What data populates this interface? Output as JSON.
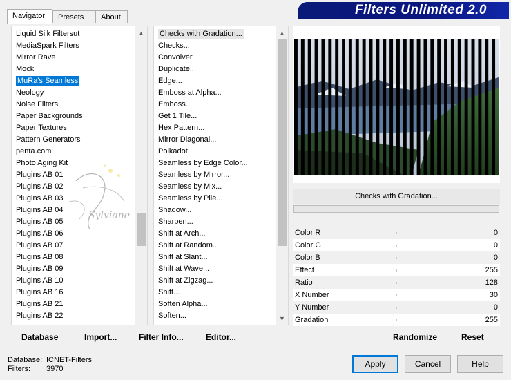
{
  "banner": {
    "title": "Filters Unlimited 2.0"
  },
  "tabs": [
    {
      "label": "Navigator",
      "active": true
    },
    {
      "label": "Presets",
      "active": false
    },
    {
      "label": "About",
      "active": false
    }
  ],
  "categories": {
    "selected_index": 4,
    "items": [
      "Liquid Silk Filtersut",
      "MediaSpark Filters",
      "Mirror Rave",
      "Mock",
      "MuRa's Seamless",
      "Neology",
      "Noise Filters",
      "Paper Backgrounds",
      "Paper Textures",
      "Pattern Generators",
      "penta.com",
      "Photo Aging Kit",
      "Plugins AB 01",
      "Plugins AB 02",
      "Plugins AB 03",
      "Plugins AB 04",
      "Plugins AB 05",
      "Plugins AB 06",
      "Plugins AB 07",
      "Plugins AB 08",
      "Plugins AB 09",
      "Plugins AB 10",
      "Plugins AB 16",
      "Plugins AB 21",
      "Plugins AB 22"
    ]
  },
  "filters": {
    "selected_index": 0,
    "items": [
      "Checks with Gradation...",
      "Checks...",
      "Convolver...",
      "Duplicate...",
      "Edge...",
      "Emboss at Alpha...",
      "Emboss...",
      "Get 1 Tile...",
      "Hex Pattern...",
      "Mirror Diagonal...",
      "Polkadot...",
      "Seamless by Edge Color...",
      "Seamless by Mirror...",
      "Seamless by Mix...",
      "Seamless by Pile...",
      "Shadow...",
      "Sharpen...",
      "Shift at Arch...",
      "Shift at Random...",
      "Shift at Slant...",
      "Shift at Wave...",
      "Shift at Zigzag...",
      "Shift...",
      "Soften Alpha...",
      "Soften..."
    ]
  },
  "preview": {
    "filter_name": "Checks with Gradation..."
  },
  "params": [
    {
      "label": "Color R",
      "value": "0"
    },
    {
      "label": "Color G",
      "value": "0"
    },
    {
      "label": "Color B",
      "value": "0"
    },
    {
      "label": "Effect",
      "value": "255"
    },
    {
      "label": "Ratio",
      "value": "128"
    },
    {
      "label": "X Number",
      "value": "30"
    },
    {
      "label": "Y Number",
      "value": "0"
    },
    {
      "label": "Gradation",
      "value": "255"
    }
  ],
  "toolbar": {
    "database": "Database",
    "import": "Import...",
    "filter_info": "Filter Info...",
    "editor": "Editor...",
    "randomize": "Randomize",
    "reset": "Reset"
  },
  "info": {
    "database_label": "Database:",
    "database_value": "ICNET-Filters",
    "filters_label": "Filters:",
    "filters_value": "3970"
  },
  "buttons": {
    "apply": "Apply",
    "cancel": "Cancel",
    "help": "Help"
  },
  "watermark": {
    "text": "Sylviane"
  }
}
